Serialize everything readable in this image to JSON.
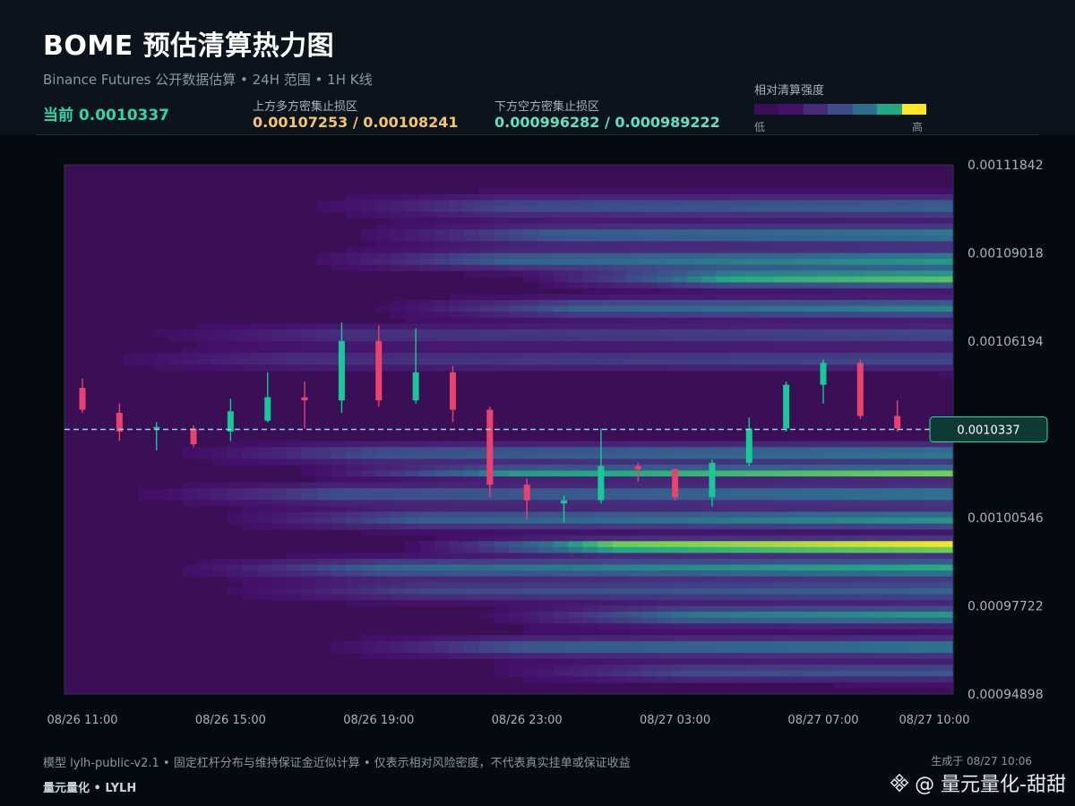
{
  "header": {
    "title": "BOME 预估清算热力图",
    "subtitle": "Binance Futures 公开数据估算 • 24H 范围 • 1H K线",
    "current_label": "当前 0.0010337",
    "upper_zone_label": "上方多方密集止损区",
    "upper_zone_values": "0.00107253 / 0.00108241",
    "lower_zone_label": "下方空方密集止损区",
    "lower_zone_values": "0.000996282 / 0.000989222",
    "legend_title": "相对清算强度",
    "legend_low": "低",
    "legend_high": "高",
    "legend_colors": [
      "#3b0f55",
      "#44106a",
      "#472a7a",
      "#3e4c8a",
      "#2f6e8e",
      "#23a884",
      "#fde725"
    ]
  },
  "colors": {
    "upper_accent": "#f5c46a",
    "lower_accent": "#5fe0c0",
    "current_accent": "#2fd6a8",
    "bull": "#18c79a",
    "bear": "#e8436e"
  },
  "chart_data": {
    "type": "candlestick-heatmap",
    "price_ticks": [
      "0.00111842",
      "0.00109018",
      "0.00106194",
      "0.00103370",
      "0.00100546",
      "0.00097722",
      "0.00094898"
    ],
    "price_tick_labels": [
      "0.00111842",
      "0.00109018",
      "0.00106194",
      "",
      "0.00100546",
      "0.00097722",
      "0.00094898"
    ],
    "ylim": [
      0.00094898,
      0.00111842
    ],
    "time_labels": [
      "08/26 11:00",
      "08/26 15:00",
      "08/26 19:00",
      "08/26 23:00",
      "08/27 03:00",
      "08/27 07:00",
      "08/27 10:00"
    ],
    "current_price": 0.0010337,
    "current_price_label": "0.0010337",
    "candles": [
      {
        "t": "08/26 11:00",
        "o": 0.001047,
        "h": 0.00105,
        "l": 0.001039,
        "c": 0.00104
      },
      {
        "t": "08/26 12:00",
        "o": 0.001039,
        "h": 0.001042,
        "l": 0.00103,
        "c": 0.001033
      },
      {
        "t": "08/26 13:00",
        "o": 0.001034,
        "h": 0.001036,
        "l": 0.001027,
        "c": 0.0010345
      },
      {
        "t": "08/26 14:00",
        "o": 0.001034,
        "h": 0.001035,
        "l": 0.001028,
        "c": 0.001029
      },
      {
        "t": "08/26 15:00",
        "o": 0.001033,
        "h": 0.0010435,
        "l": 0.00103,
        "c": 0.0010395
      },
      {
        "t": "08/26 16:00",
        "o": 0.0010365,
        "h": 0.001052,
        "l": 0.001036,
        "c": 0.001044
      },
      {
        "t": "08/26 17:00",
        "o": 0.001044,
        "h": 0.001049,
        "l": 0.001034,
        "c": 0.001043
      },
      {
        "t": "08/26 18:00",
        "o": 0.001043,
        "h": 0.001068,
        "l": 0.001039,
        "c": 0.001062
      },
      {
        "t": "08/26 19:00",
        "o": 0.001062,
        "h": 0.001067,
        "l": 0.001041,
        "c": 0.001043
      },
      {
        "t": "08/26 20:00",
        "o": 0.001043,
        "h": 0.001066,
        "l": 0.001042,
        "c": 0.001052
      },
      {
        "t": "08/26 21:00",
        "o": 0.001052,
        "h": 0.001054,
        "l": 0.001036,
        "c": 0.00104
      },
      {
        "t": "08/26 22:00",
        "o": 0.00104,
        "h": 0.001041,
        "l": 0.001012,
        "c": 0.001016
      },
      {
        "t": "08/26 23:00",
        "o": 0.001016,
        "h": 0.001018,
        "l": 0.001005,
        "c": 0.001011
      },
      {
        "t": "08/27 00:00",
        "o": 0.00101,
        "h": 0.0010125,
        "l": 0.001004,
        "c": 0.001011
      },
      {
        "t": "08/27 01:00",
        "o": 0.001011,
        "h": 0.001034,
        "l": 0.00101,
        "c": 0.001022
      },
      {
        "t": "08/27 02:00",
        "o": 0.001022,
        "h": 0.001023,
        "l": 0.001017,
        "c": 0.001021
      },
      {
        "t": "08/27 03:00",
        "o": 0.001021,
        "h": 0.001021,
        "l": 0.001011,
        "c": 0.001012
      },
      {
        "t": "08/27 04:00",
        "o": 0.001012,
        "h": 0.001024,
        "l": 0.001009,
        "c": 0.001023
      },
      {
        "t": "08/27 05:00",
        "o": 0.001023,
        "h": 0.0010375,
        "l": 0.001022,
        "c": 0.001034
      },
      {
        "t": "08/27 06:00",
        "o": 0.001034,
        "h": 0.001049,
        "l": 0.001033,
        "c": 0.001048
      },
      {
        "t": "08/27 07:00",
        "o": 0.001048,
        "h": 0.001056,
        "l": 0.001042,
        "c": 0.001055
      },
      {
        "t": "08/27 08:00",
        "o": 0.001055,
        "h": 0.001056,
        "l": 0.001037,
        "c": 0.001038
      },
      {
        "t": "08/27 09:00",
        "o": 0.001038,
        "h": 0.001043,
        "l": 0.001033,
        "c": 0.001034
      }
    ],
    "grid": false
  },
  "footer": {
    "note": "模型 lylh-public-v2.1 • 固定杠杆分布与维持保证金近似计算 • 仅表示相对风险密度，不代表真实挂单或保证收益",
    "brand": "量元量化 • LYLH",
    "generated": "生成于 08/27 10:06",
    "watermark": "@ 量元量化-甜甜"
  }
}
